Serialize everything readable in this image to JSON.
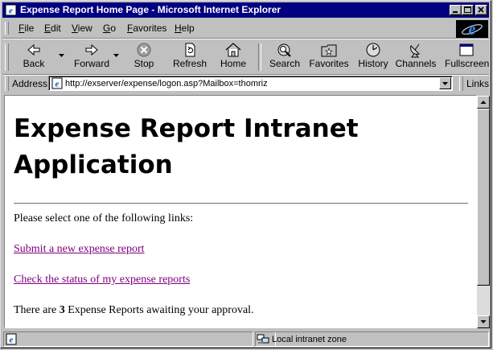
{
  "window": {
    "title": "Expense Report Home Page - Microsoft Internet Explorer"
  },
  "menu": {
    "items": [
      {
        "label": "File",
        "key": "F",
        "rest": "ile"
      },
      {
        "label": "Edit",
        "key": "E",
        "rest": "dit"
      },
      {
        "label": "View",
        "key": "V",
        "rest": "iew"
      },
      {
        "label": "Go",
        "key": "G",
        "rest": "o"
      },
      {
        "label": "Favorites",
        "key": "F",
        "rest": "avorites"
      },
      {
        "label": "Help",
        "key": "H",
        "rest": "elp"
      }
    ]
  },
  "toolbar": {
    "back": "Back",
    "forward": "Forward",
    "stop": "Stop",
    "refresh": "Refresh",
    "home": "Home",
    "search": "Search",
    "favorites": "Favorites",
    "history": "History",
    "channels": "Channels",
    "fullscreen": "Fullscreen"
  },
  "address": {
    "label": "Address",
    "url": "http://exserver/expense/logon.asp?Mailbox=thomriz",
    "links_label": "Links"
  },
  "page": {
    "title_line1": "Expense Report Intranet",
    "title_line2": "Application",
    "intro": "Please select one of the following links:",
    "link_submit": "Submit a new expense report",
    "link_status": "Check the status of my expense reports",
    "awaiting_prefix": "There are ",
    "awaiting_count": "3",
    "awaiting_suffix": " Expense Reports awaiting your approval."
  },
  "status": {
    "zone": "Local intranet zone"
  },
  "colors": {
    "title_bar": "#000080",
    "visited_link": "#800080",
    "chrome": "#c0c0c0"
  }
}
